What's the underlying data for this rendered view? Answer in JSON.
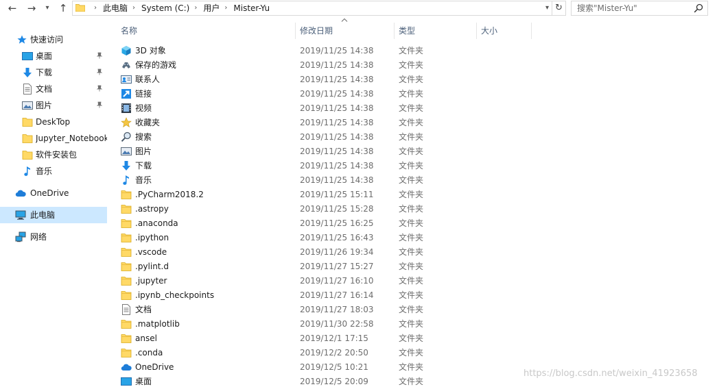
{
  "address": {
    "path": [
      "此电脑",
      "System (C:)",
      "用户",
      "Mister-Yu"
    ]
  },
  "search": {
    "placeholder": "搜索\"Mister-Yu\""
  },
  "sidebar": {
    "quick_access": "快速访问",
    "quick_items": [
      {
        "label": "桌面",
        "icon": "desktop-icon",
        "pinned": true
      },
      {
        "label": "下载",
        "icon": "download-arrow-icon",
        "pinned": true
      },
      {
        "label": "文档",
        "icon": "document-icon",
        "pinned": true
      },
      {
        "label": "图片",
        "icon": "picture-icon",
        "pinned": true
      },
      {
        "label": "DeskTop",
        "icon": "folder-icon",
        "pinned": false
      },
      {
        "label": "Jupyter_Notebook",
        "icon": "folder-icon",
        "pinned": false
      },
      {
        "label": "软件安装包",
        "icon": "folder-icon",
        "pinned": false
      },
      {
        "label": "音乐",
        "icon": "music-icon",
        "pinned": false
      }
    ],
    "onedrive": "OneDrive",
    "this_pc": "此电脑",
    "network": "网络"
  },
  "columns": {
    "name": "名称",
    "date": "修改日期",
    "type": "类型",
    "size": "大小"
  },
  "files": [
    {
      "name": "3D 对象",
      "date": "2019/11/25 14:38",
      "type": "文件夹",
      "icon": "3d-objects"
    },
    {
      "name": "保存的游戏",
      "date": "2019/11/25 14:38",
      "type": "文件夹",
      "icon": "saved-games"
    },
    {
      "name": "联系人",
      "date": "2019/11/25 14:38",
      "type": "文件夹",
      "icon": "contacts"
    },
    {
      "name": "链接",
      "date": "2019/11/25 14:38",
      "type": "文件夹",
      "icon": "links"
    },
    {
      "name": "视频",
      "date": "2019/11/25 14:38",
      "type": "文件夹",
      "icon": "video"
    },
    {
      "name": "收藏夹",
      "date": "2019/11/25 14:38",
      "type": "文件夹",
      "icon": "favorites"
    },
    {
      "name": "搜索",
      "date": "2019/11/25 14:38",
      "type": "文件夹",
      "icon": "searches"
    },
    {
      "name": "图片",
      "date": "2019/11/25 14:38",
      "type": "文件夹",
      "icon": "pictures"
    },
    {
      "name": "下载",
      "date": "2019/11/25 14:38",
      "type": "文件夹",
      "icon": "downloads"
    },
    {
      "name": "音乐",
      "date": "2019/11/25 14:38",
      "type": "文件夹",
      "icon": "music"
    },
    {
      "name": ".PyCharm2018.2",
      "date": "2019/11/25 15:11",
      "type": "文件夹",
      "icon": "folder"
    },
    {
      "name": ".astropy",
      "date": "2019/11/25 15:28",
      "type": "文件夹",
      "icon": "folder"
    },
    {
      "name": ".anaconda",
      "date": "2019/11/25 16:25",
      "type": "文件夹",
      "icon": "folder"
    },
    {
      "name": ".ipython",
      "date": "2019/11/25 16:43",
      "type": "文件夹",
      "icon": "folder"
    },
    {
      "name": ".vscode",
      "date": "2019/11/26 19:34",
      "type": "文件夹",
      "icon": "folder"
    },
    {
      "name": ".pylint.d",
      "date": "2019/11/27 15:27",
      "type": "文件夹",
      "icon": "folder"
    },
    {
      "name": ".jupyter",
      "date": "2019/11/27 16:10",
      "type": "文件夹",
      "icon": "folder"
    },
    {
      "name": ".ipynb_checkpoints",
      "date": "2019/11/27 16:14",
      "type": "文件夹",
      "icon": "folder"
    },
    {
      "name": "文档",
      "date": "2019/11/27 18:03",
      "type": "文件夹",
      "icon": "documents"
    },
    {
      "name": ".matplotlib",
      "date": "2019/11/30 22:58",
      "type": "文件夹",
      "icon": "folder"
    },
    {
      "name": "ansel",
      "date": "2019/12/1 17:15",
      "type": "文件夹",
      "icon": "folder"
    },
    {
      "name": ".conda",
      "date": "2019/12/2 20:50",
      "type": "文件夹",
      "icon": "folder"
    },
    {
      "name": "OneDrive",
      "date": "2019/12/5 10:21",
      "type": "文件夹",
      "icon": "onedrive"
    },
    {
      "name": "桌面",
      "date": "2019/12/5 20:09",
      "type": "文件夹",
      "icon": "desktop"
    }
  ],
  "watermark": "https://blog.csdn.net/weixin_41923658",
  "colors": {
    "selected_bg": "#cce8ff",
    "folder": "#ffd966",
    "accent_blue": "#1e88e5"
  }
}
